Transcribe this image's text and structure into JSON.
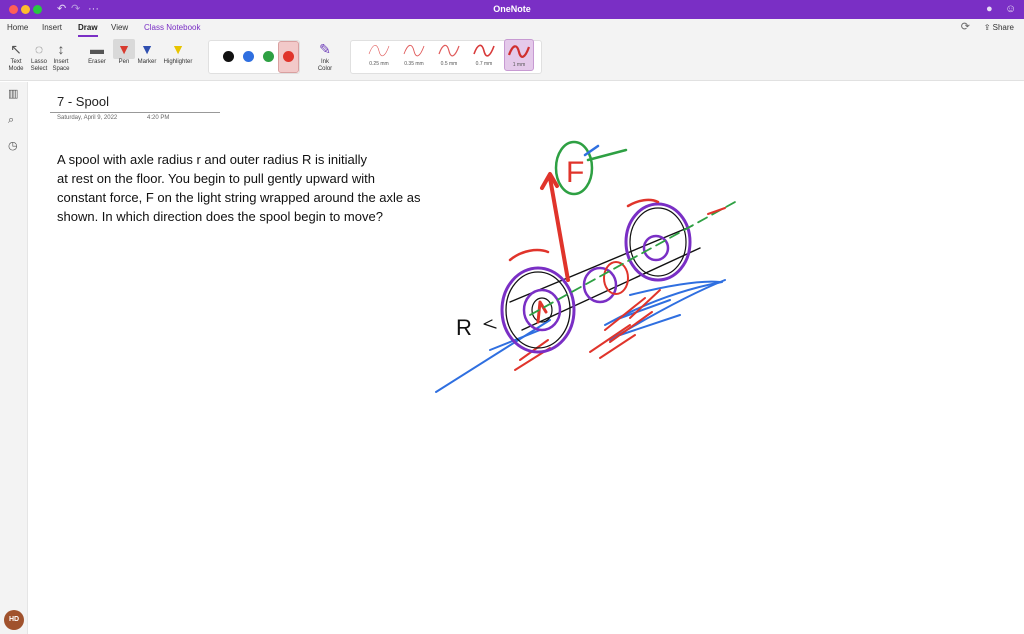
{
  "window": {
    "title": "OneNote"
  },
  "menu": {
    "tabs": [
      {
        "label": "Home"
      },
      {
        "label": "Insert"
      },
      {
        "label": "Draw"
      },
      {
        "label": "View"
      },
      {
        "label": "Class Notebook"
      }
    ],
    "share_label": "Share"
  },
  "ribbon": {
    "text_mode": "Text\nMode",
    "lasso_select": "Lasso\nSelect",
    "insert_space": "Insert\nSpace",
    "eraser": "Eraser",
    "pen": "Pen",
    "marker": "Marker",
    "highlighter": "Highlighter",
    "ink_color": "Ink\nColor",
    "colors": [
      "#111111",
      "#2f6fe0",
      "#2ea043",
      "#e0342b"
    ],
    "thicknesses": [
      "0.25 mm",
      "0.35 mm",
      "0.5 mm",
      "0.7 mm",
      "1 mm"
    ]
  },
  "page": {
    "title": "7 - Spool",
    "date": "Saturday, April 9, 2022",
    "time": "4:20 PM",
    "body_lines": [
      "A spool with axle radius r and outer radius R is initially",
      "at rest on the floor. You begin to pull gently upward with",
      "constant force, F on the light string wrapped around the axle as",
      "shown. In which direction does the spool begin to move?"
    ],
    "sketch_labels": {
      "force": "F",
      "radius": "R"
    }
  },
  "user": {
    "initials": "HD"
  }
}
